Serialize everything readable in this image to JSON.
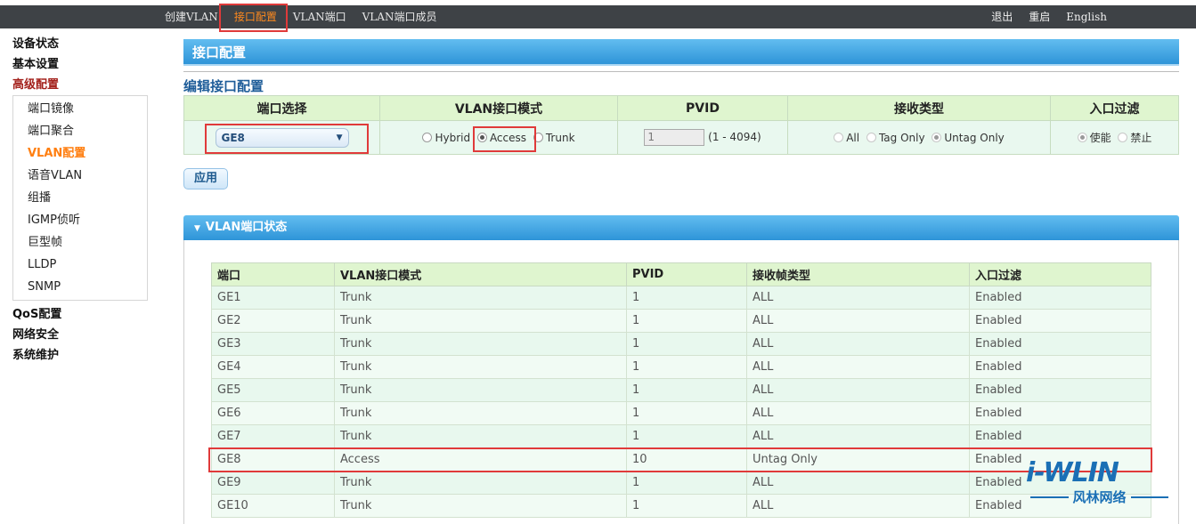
{
  "top_nav": {
    "items": [
      "创建VLAN",
      "接口配置",
      "VLAN端口",
      "VLAN端口成员"
    ],
    "active_index": 1,
    "right": [
      "退出",
      "重启",
      "English"
    ]
  },
  "sidebar": {
    "main_before": [
      "设备状态",
      "基本设置",
      "高级配置"
    ],
    "active_main": "高级配置",
    "sub_items": [
      "端口镜像",
      "端口聚合",
      "VLAN配置",
      "语音VLAN",
      "组播",
      "IGMP侦听",
      "巨型帧",
      "LLDP",
      "SNMP"
    ],
    "active_sub": "VLAN配置",
    "main_after": [
      "QoS配置",
      "网络安全",
      "系统维护"
    ]
  },
  "page": {
    "title": "接口配置",
    "subtitle": "编辑接口配置",
    "apply_label": "应用"
  },
  "config_table": {
    "headers": [
      "端口选择",
      "VLAN接口模式",
      "PVID",
      "接收类型",
      "入口过滤"
    ],
    "port_selected": "GE8",
    "mode_options": [
      "Hybrid",
      "Access",
      "Trunk"
    ],
    "mode_selected": "Access",
    "pvid_value": "1",
    "pvid_range": "(1 - 4094)",
    "accept_options": [
      "All",
      "Tag Only",
      "Untag Only"
    ],
    "accept_selected": "Untag Only",
    "filter_options": [
      "使能",
      "禁止"
    ],
    "filter_selected": "使能"
  },
  "status": {
    "title": "VLAN端口状态",
    "headers": [
      "端口",
      "VLAN接口模式",
      "PVID",
      "接收帧类型",
      "入口过滤"
    ],
    "rows": [
      [
        "GE1",
        "Trunk",
        "1",
        "ALL",
        "Enabled"
      ],
      [
        "GE2",
        "Trunk",
        "1",
        "ALL",
        "Enabled"
      ],
      [
        "GE3",
        "Trunk",
        "1",
        "ALL",
        "Enabled"
      ],
      [
        "GE4",
        "Trunk",
        "1",
        "ALL",
        "Enabled"
      ],
      [
        "GE5",
        "Trunk",
        "1",
        "ALL",
        "Enabled"
      ],
      [
        "GE6",
        "Trunk",
        "1",
        "ALL",
        "Enabled"
      ],
      [
        "GE7",
        "Trunk",
        "1",
        "ALL",
        "Enabled"
      ],
      [
        "GE8",
        "Access",
        "10",
        "Untag Only",
        "Enabled"
      ],
      [
        "GE9",
        "Trunk",
        "1",
        "ALL",
        "Enabled"
      ],
      [
        "GE10",
        "Trunk",
        "1",
        "ALL",
        "Enabled"
      ]
    ]
  },
  "watermark": {
    "logo": "i-WLIN",
    "sub": "风林网络"
  },
  "colors": {
    "topbar": "#3e4246",
    "active_orange": "#ff8a1e",
    "header_blue": "#2e94d8",
    "table_header": "#dff5cf",
    "highlight_red": "#e03a3a",
    "active_sidebar": "#a3201b"
  }
}
